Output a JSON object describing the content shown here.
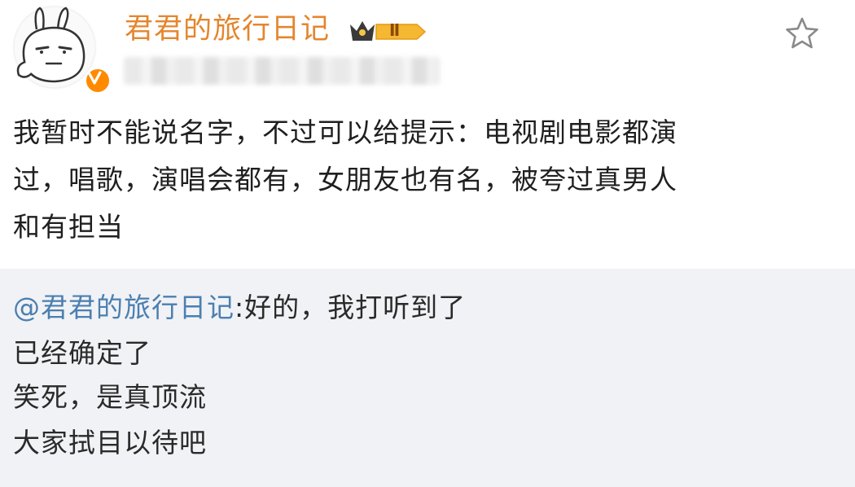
{
  "post": {
    "username": "君君的旅行日记",
    "vip_badge_text": "Ⅱ",
    "verified_icon": "v-check-icon",
    "favorite_icon": "star-outline-icon",
    "body": "我暂时不能说名字，不过可以给提示：电视剧电影都演\n过，唱歌，演唱会都有，女朋友也有名，被夸过真男人\n和有担当"
  },
  "reply": {
    "mention": "@君君的旅行日记",
    "first_line_rest": ":好的，我打听到了",
    "lines": [
      "已经确定了",
      "笑死，是真顶流",
      "大家拭目以待吧"
    ]
  },
  "colors": {
    "username": "#e4862e",
    "mention": "#4b7fb1",
    "reply_bg": "#f1f2f5",
    "verified": "#ff8a00"
  }
}
